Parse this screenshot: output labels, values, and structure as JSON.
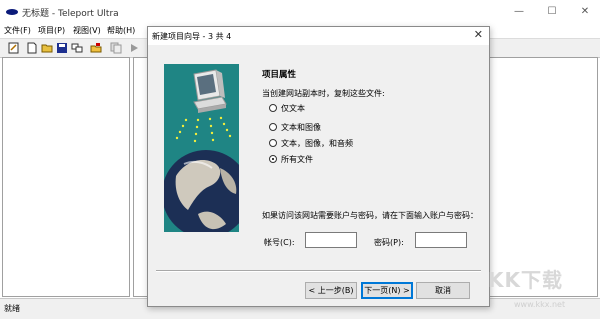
{
  "window": {
    "title": "无标题 - Teleport Ultra",
    "controls": {
      "minimize": "—",
      "maximize": "☐",
      "close": "✕"
    }
  },
  "menu": [
    "文件(F)",
    "项目(P)",
    "视图(V)",
    "帮助(H)"
  ],
  "status": {
    "text": "就绪"
  },
  "dialog": {
    "title": "新建项目向导 - 3 共 4",
    "close": "✕",
    "heading": "项目属性",
    "prompt": "当创建网站副本时，复制这些文件:",
    "options": [
      "仅文本",
      "文本和图像",
      "文本，图像，和音频",
      "所有文件"
    ],
    "selected_index": 3,
    "account_note": "如果访问该网站需要账户与密码，请在下面输入账户与密码：",
    "account_label": "帐号(C):",
    "account_value": "",
    "password_label": "密码(P):",
    "password_value": "",
    "buttons": {
      "back": "< 上一步(B)",
      "next": "下一页(N) >",
      "cancel": "取消"
    }
  },
  "watermark": {
    "text": "KK下载",
    "url": "www.kkx.net"
  }
}
